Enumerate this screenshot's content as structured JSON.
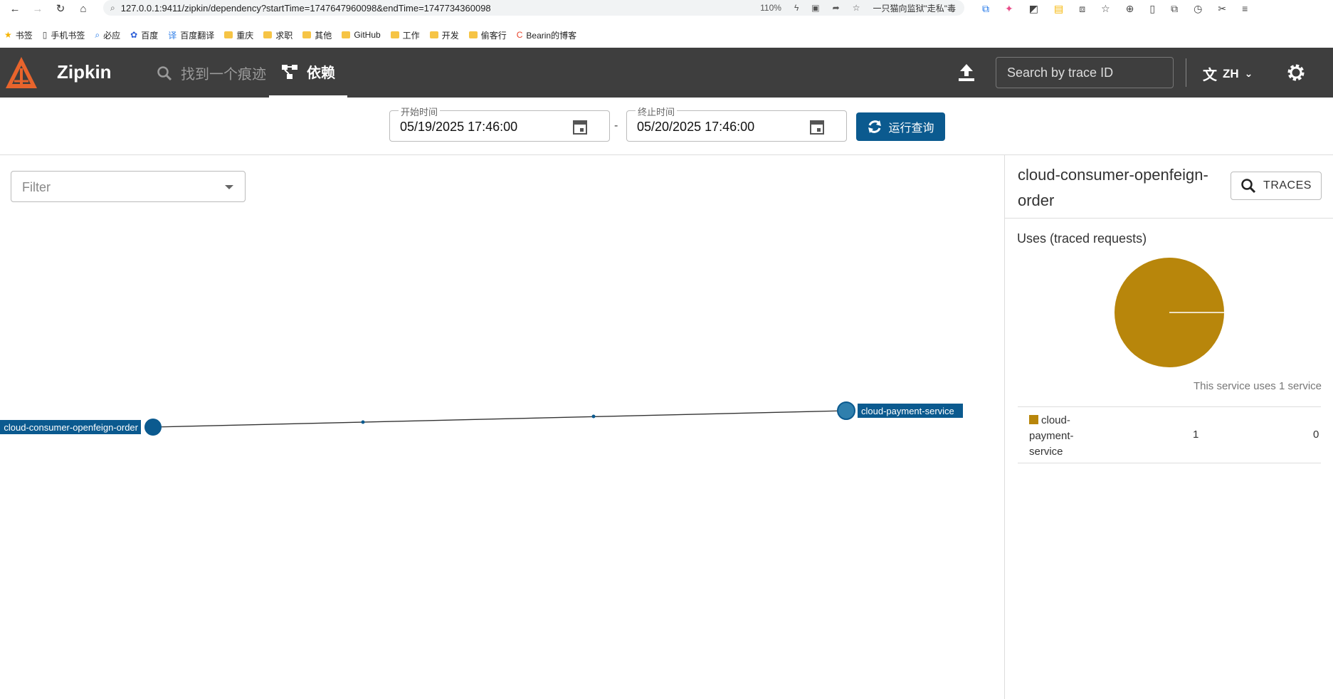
{
  "browser": {
    "url": "127.0.0.1:9411/zipkin/dependency?startTime=1747647960098&endTime=1747734360098",
    "zoom": "110%",
    "search_snippet": "一只猫向监狱\"走私\"毒"
  },
  "bookmarks": [
    {
      "label": "书签",
      "icon": "star-icon"
    },
    {
      "label": "手机书签",
      "icon": "phone-icon"
    },
    {
      "label": "必应",
      "icon": "search-icon"
    },
    {
      "label": "百度",
      "icon": "paw-icon"
    },
    {
      "label": "百度翻译",
      "icon": "translate-icon"
    },
    {
      "label": "重庆",
      "icon": "folder-icon"
    },
    {
      "label": "求职",
      "icon": "folder-icon"
    },
    {
      "label": "其他",
      "icon": "folder-icon"
    },
    {
      "label": "GitHub",
      "icon": "folder-icon"
    },
    {
      "label": "工作",
      "icon": "folder-icon"
    },
    {
      "label": "开发",
      "icon": "folder-icon"
    },
    {
      "label": "偷客行",
      "icon": "folder-icon"
    },
    {
      "label": "Bearin的博客",
      "icon": "csdn-icon"
    }
  ],
  "header": {
    "brand": "Zipkin",
    "nav_find": "找到一个痕迹",
    "nav_dependencies": "依赖",
    "search_placeholder": "Search by trace ID",
    "language": "ZH"
  },
  "toolbar": {
    "start_label": "开始时间",
    "start_value": "05/19/2025 17:46:00",
    "end_label": "终止时间",
    "end_value": "05/20/2025 17:46:00",
    "separator": "-",
    "run_label": "运行查询"
  },
  "graph": {
    "filter_placeholder": "Filter",
    "nodes": [
      "cloud-consumer-openfeign-order",
      "cloud-payment-service"
    ]
  },
  "panel": {
    "service_name": "cloud-consumer-openfeign-order",
    "traces_label": "TRACES",
    "uses_title": "Uses (traced requests)",
    "uses_note": "This service uses 1 service",
    "rows": [
      {
        "name": "cloud-payment-service",
        "count": "1",
        "errors": "0",
        "color": "#b8860b"
      }
    ]
  },
  "colors": {
    "header_bg": "#3e3e3e",
    "accent": "#0b5a8f",
    "pie": "#b8860b",
    "node": "#0b5a8f",
    "node_light": "#2f7fad"
  }
}
